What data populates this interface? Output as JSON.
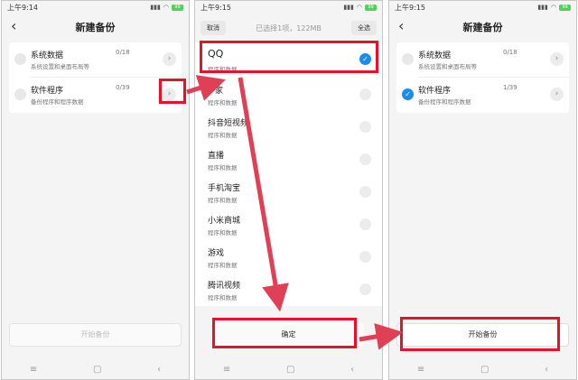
{
  "colors": {
    "accent_blue": "#1a8cf0",
    "annotation_red": "#e8102a",
    "battery_green": "#4cd35a"
  },
  "phone1": {
    "status": {
      "time": "上午9:14",
      "battery": "99"
    },
    "title": "新建备份",
    "rows": [
      {
        "name": "系统数据",
        "sub": "系统设置和桌面布局等",
        "count": "0/18",
        "checked": false
      },
      {
        "name": "软件程序",
        "sub": "备份程序和程序数据",
        "count": "0/39",
        "checked": false
      }
    ],
    "start_button": "开始备份"
  },
  "phone2": {
    "status": {
      "time": "上午9:15",
      "battery": "99"
    },
    "cancel": "取消",
    "selection_status": "已选择1项，122MB",
    "select_all": "全选",
    "apps": [
      {
        "name": "QQ",
        "sub": "程序和数据",
        "checked": true
      },
      {
        "name": "家",
        "sub": "程序和数据",
        "checked": false
      },
      {
        "name": "抖音短视频",
        "sub": "程序和数据",
        "checked": false
      },
      {
        "name": "直播",
        "sub": "程序和数据",
        "checked": false
      },
      {
        "name": "手机淘宝",
        "sub": "程序和数据",
        "checked": false
      },
      {
        "name": "小米商城",
        "sub": "程序和数据",
        "checked": false
      },
      {
        "name": "游戏",
        "sub": "程序和数据",
        "checked": false
      },
      {
        "name": "腾讯视频",
        "sub": "程序和数据",
        "checked": false
      }
    ],
    "confirm": "确定"
  },
  "phone3": {
    "status": {
      "time": "上午9:15",
      "battery": "99"
    },
    "title": "新建备份",
    "rows": [
      {
        "name": "系统数据",
        "sub": "系统设置和桌面布局等",
        "count": "0/18",
        "checked": false
      },
      {
        "name": "软件程序",
        "sub": "备份程序和程序数据",
        "count": "1/39",
        "checked": true
      }
    ],
    "start_button": "开始备份"
  },
  "icons": {
    "back": "back-arrow-icon",
    "chevron": "chevron-right-icon",
    "check": "checkmark-icon",
    "nav_menu": "menu-icon",
    "nav_home": "home-icon",
    "nav_back": "back-icon",
    "wifi": "wifi-icon",
    "signal": "signal-icon"
  }
}
